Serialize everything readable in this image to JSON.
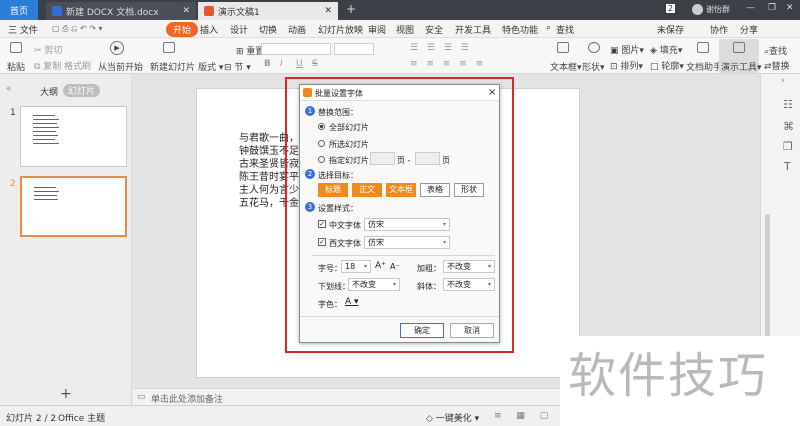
{
  "titlebar": {
    "home_tab": "首页",
    "doc_tab": "新建 DOCX 文档.docx",
    "ppt_tab": "演示文稿1",
    "new_tab": "+",
    "badge": "2",
    "user": "谢怡群"
  },
  "menubar": {
    "file": "三 文件",
    "items": [
      "开始",
      "插入",
      "设计",
      "切换",
      "动画",
      "幻灯片放映",
      "审阅",
      "视图",
      "安全",
      "开发工具",
      "特色功能"
    ],
    "search": "查找",
    "unsaved": "未保存",
    "collab": "协作",
    "share": "分享"
  },
  "ribbon": {
    "paste": "粘贴",
    "cut": "剪切",
    "copy": "复制",
    "format_painter": "格式刷",
    "from_current": "从当前开始",
    "new_slide": "新建幻灯片",
    "layout": "版式",
    "section": "节",
    "reset": "重置",
    "bold": "B",
    "italic": "I",
    "underline": "U",
    "strike": "S",
    "textbox": "文本框",
    "shape": "形状",
    "image": "图片",
    "fill": "填充",
    "arrange": "排列",
    "outline": "轮廓",
    "doc_assistant": "文档助手",
    "present_tool": "演示工具",
    "find": "查找",
    "replace": "替换"
  },
  "leftpane": {
    "outline_tab": "大纲",
    "slides_tab": "幻灯片",
    "slide_nums": [
      "1",
      "2"
    ],
    "add": "+"
  },
  "slide": {
    "lines": [
      "与君歌一曲，",
      "钟鼓馔玉不足",
      "古来圣贤皆寂",
      "陈王昔时宴平",
      "主人何为言少",
      "五花马，千金"
    ]
  },
  "dialog": {
    "title": "批量设置字体",
    "close": "×",
    "section1": {
      "num": "1",
      "label": "替换范围："
    },
    "range_all": "全部幻灯片",
    "range_selected": "所选幻灯片",
    "range_specified": "指定幻灯片",
    "page1": "页 -",
    "page2": "页",
    "section2": {
      "num": "2",
      "label": "选择目标："
    },
    "targets": [
      "标题",
      "正文",
      "文本框",
      "表格",
      "形状"
    ],
    "section3": {
      "num": "3",
      "label": "设置样式："
    },
    "cn_font_label": "中文字体",
    "cn_font_value": "仿宋",
    "west_font_label": "西文字体",
    "west_font_value": "仿宋",
    "size_label": "字号：",
    "size_value": "18",
    "bold_label": "加粗：",
    "bold_value": "不改变",
    "underline_label": "下划线：",
    "underline_value": "不改变",
    "italic_label": "斜体：",
    "italic_value": "不改变",
    "color_label": "字色：",
    "color_value": "A",
    "ok": "确定",
    "cancel": "取消"
  },
  "notes": {
    "placeholder": "单击此处添加备注"
  },
  "status": {
    "slide_count": "幻灯片 2 / 2",
    "theme": "Office 主题",
    "beautify": "一键美化"
  },
  "watermark": "软件技巧",
  "colors": {
    "accent": "#f26522",
    "highlight": "#e0252a",
    "dialog_orange": "#f08a1d",
    "num_blue": "#3a6fd8"
  }
}
